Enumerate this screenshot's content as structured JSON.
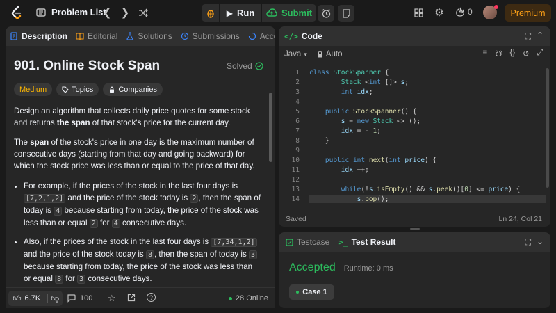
{
  "topbar": {
    "problem_list": "Problem List",
    "run_label": "Run",
    "submit_label": "Submit",
    "streak_count": "0",
    "premium_label": "Premium"
  },
  "description_panel": {
    "tabs": [
      {
        "label": "Description"
      },
      {
        "label": "Editorial"
      },
      {
        "label": "Solutions"
      },
      {
        "label": "Submissions"
      },
      {
        "label": "Accep"
      }
    ],
    "title": "901. Online Stock Span",
    "solved_label": "Solved",
    "chips": [
      "Medium",
      "Topics",
      "Companies"
    ],
    "para1_a": "Design an algorithm that collects daily price quotes for some stock and returns ",
    "para1_b": "the span",
    "para1_c": " of that stock's price for the current day.",
    "para2_a": "The ",
    "para2_b": "span",
    "para2_c": " of the stock's price in one day is the maximum number of consecutive days (starting from that day and going backward) for which the stock price was less than or equal to the price of that day.",
    "bullet1": {
      "t1": "For example, if the prices of the stock in the last four days is ",
      "c1": "[7,2,1,2]",
      "t2": " and the price of the stock today is ",
      "c2": "2",
      "t3": ", then the span of today is ",
      "c3": "4",
      "t4": " because starting from today, the price of the stock was less than or equal ",
      "c4": "2",
      "t5": " for ",
      "c5": "4",
      "t6": " consecutive days."
    },
    "bullet2": {
      "t1": "Also, if the prices of the stock in the last four days is ",
      "c1": "[7,34,1,2]",
      "t2": " and the price of the stock today is ",
      "c2": "8",
      "t3": ", then the span of today is ",
      "c3": "3",
      "t4": " because starting from today, the price of the stock was less than or equal ",
      "c4": "8",
      "t5": " for ",
      "c5": "3",
      "t6": " consecutive days."
    },
    "footer": {
      "likes": "6.7K",
      "comments": "100",
      "online": "28 Online"
    }
  },
  "code_panel": {
    "tab_label": "Code",
    "language": "Java",
    "mode": "Auto",
    "lines": [
      {
        "n": "1"
      },
      {
        "n": "2"
      },
      {
        "n": "3"
      },
      {
        "n": "4"
      },
      {
        "n": "5"
      },
      {
        "n": "6"
      },
      {
        "n": "7"
      },
      {
        "n": "8"
      },
      {
        "n": "9"
      },
      {
        "n": "10"
      },
      {
        "n": "11"
      },
      {
        "n": "12"
      },
      {
        "n": "13"
      },
      {
        "n": "14"
      }
    ],
    "status_left": "Saved",
    "status_right": "Ln 24, Col 21"
  },
  "result_panel": {
    "tab_testcase": "Testcase",
    "tab_result": "Test Result",
    "verdict": "Accepted",
    "runtime": "Runtime: 0 ms",
    "case_label": "Case 1",
    "colors": {
      "accepted": "#2cbb5d"
    }
  }
}
